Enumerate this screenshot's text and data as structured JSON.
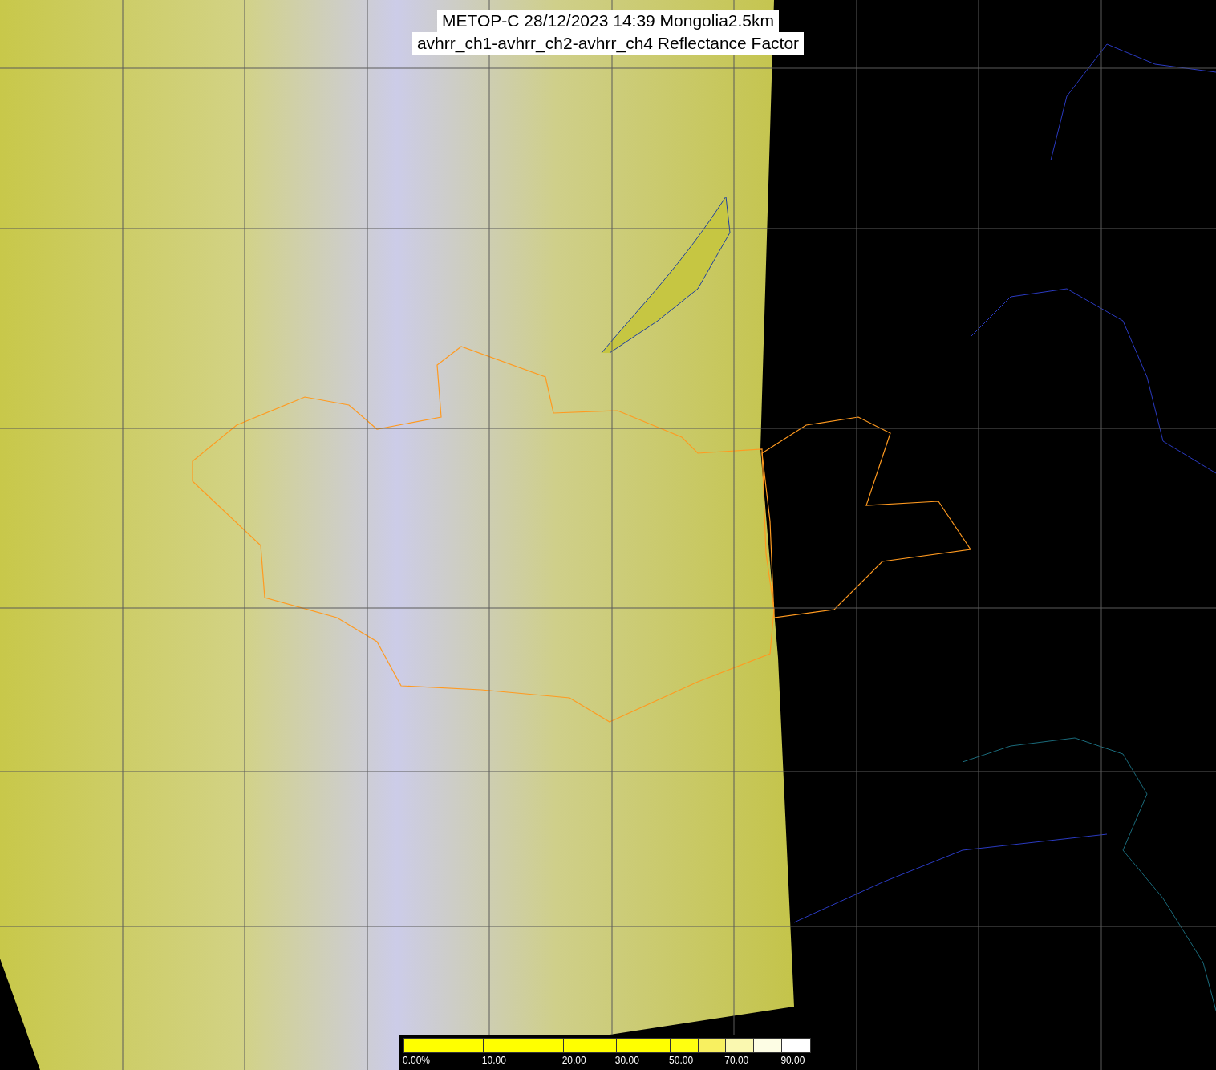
{
  "title": {
    "lines": [
      "METOP-C 28/12/2023 14:39 Mongolia2.5km",
      "avhrr_ch1-avhrr_ch2-avhrr_ch4 Reflectance Factor"
    ]
  },
  "colorbar": {
    "segments": [
      {
        "color": "#ffff00",
        "label": "0.00%"
      },
      {
        "color": "#ffff00",
        "label": "10.00"
      },
      {
        "color": "#ffff00",
        "label": "20.00"
      },
      {
        "color": "#ffff00",
        "label": "30.00"
      },
      {
        "color": "#ffff00"
      },
      {
        "color": "#ffff10",
        "label": "50.00"
      },
      {
        "color": "#f8f060"
      },
      {
        "color": "#faf8b0",
        "label": "70.00"
      },
      {
        "color": "#fdfde4"
      },
      {
        "color": "#ffffff",
        "label": "90.00"
      }
    ]
  }
}
